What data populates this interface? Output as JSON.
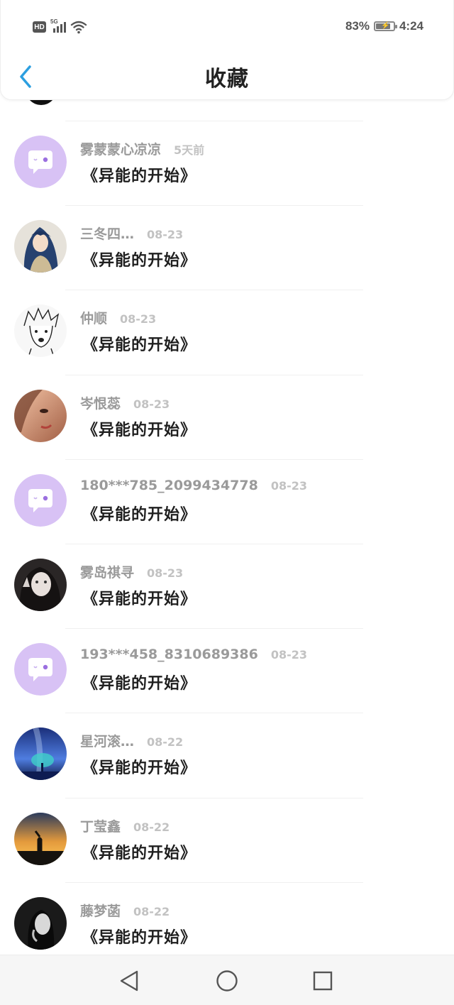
{
  "status_bar": {
    "hd": "HD",
    "network": "5G",
    "signal_level": 4,
    "battery_percent_text": "83%",
    "battery_level": 0.83,
    "time": "4:24"
  },
  "header": {
    "title": "收藏",
    "back_icon": "chevron-left-icon",
    "accent_color": "#2c9fe0"
  },
  "favorites": [
    {
      "name": "雾蒙蒙心凉凉",
      "date": "5天前",
      "book": "《异能的开始》",
      "avatar": "default-chat-avatar"
    },
    {
      "name": "三冬四…",
      "date": "08-23",
      "book": "《异能的开始》",
      "avatar": "blue-hair-girl"
    },
    {
      "name": "仲顺",
      "date": "08-23",
      "book": "《异能的开始》",
      "avatar": "sketch-boy"
    },
    {
      "name": "岑恨蕊",
      "date": "08-23",
      "book": "《异能的开始》",
      "avatar": "warm-portrait"
    },
    {
      "name": "180***785_2099434778",
      "date": "08-23",
      "book": "《异能的开始》",
      "avatar": "default-chat-avatar"
    },
    {
      "name": "雾岛祺寻",
      "date": "08-23",
      "book": "《异能的开始》",
      "avatar": "dark-selfie"
    },
    {
      "name": "193***458_8310689386",
      "date": "08-23",
      "book": "《异能的开始》",
      "avatar": "default-chat-avatar"
    },
    {
      "name": "星河滚…",
      "date": "08-22",
      "book": "《异能的开始》",
      "avatar": "galaxy-tree"
    },
    {
      "name": "丁莹鑫",
      "date": "08-22",
      "book": "《异能的开始》",
      "avatar": "sunset-silhouette"
    },
    {
      "name": "藤梦菡",
      "date": "08-22",
      "book": "《异能的开始》",
      "avatar": "bw-portrait"
    }
  ],
  "colors": {
    "default_avatar_bg": "#d8c2f5",
    "name_text": "#9a9a9a",
    "date_text": "#c2c2c2"
  },
  "nav": {
    "back_icon": "triangle-back-icon",
    "home_icon": "circle-home-icon",
    "recents_icon": "square-recents-icon"
  }
}
